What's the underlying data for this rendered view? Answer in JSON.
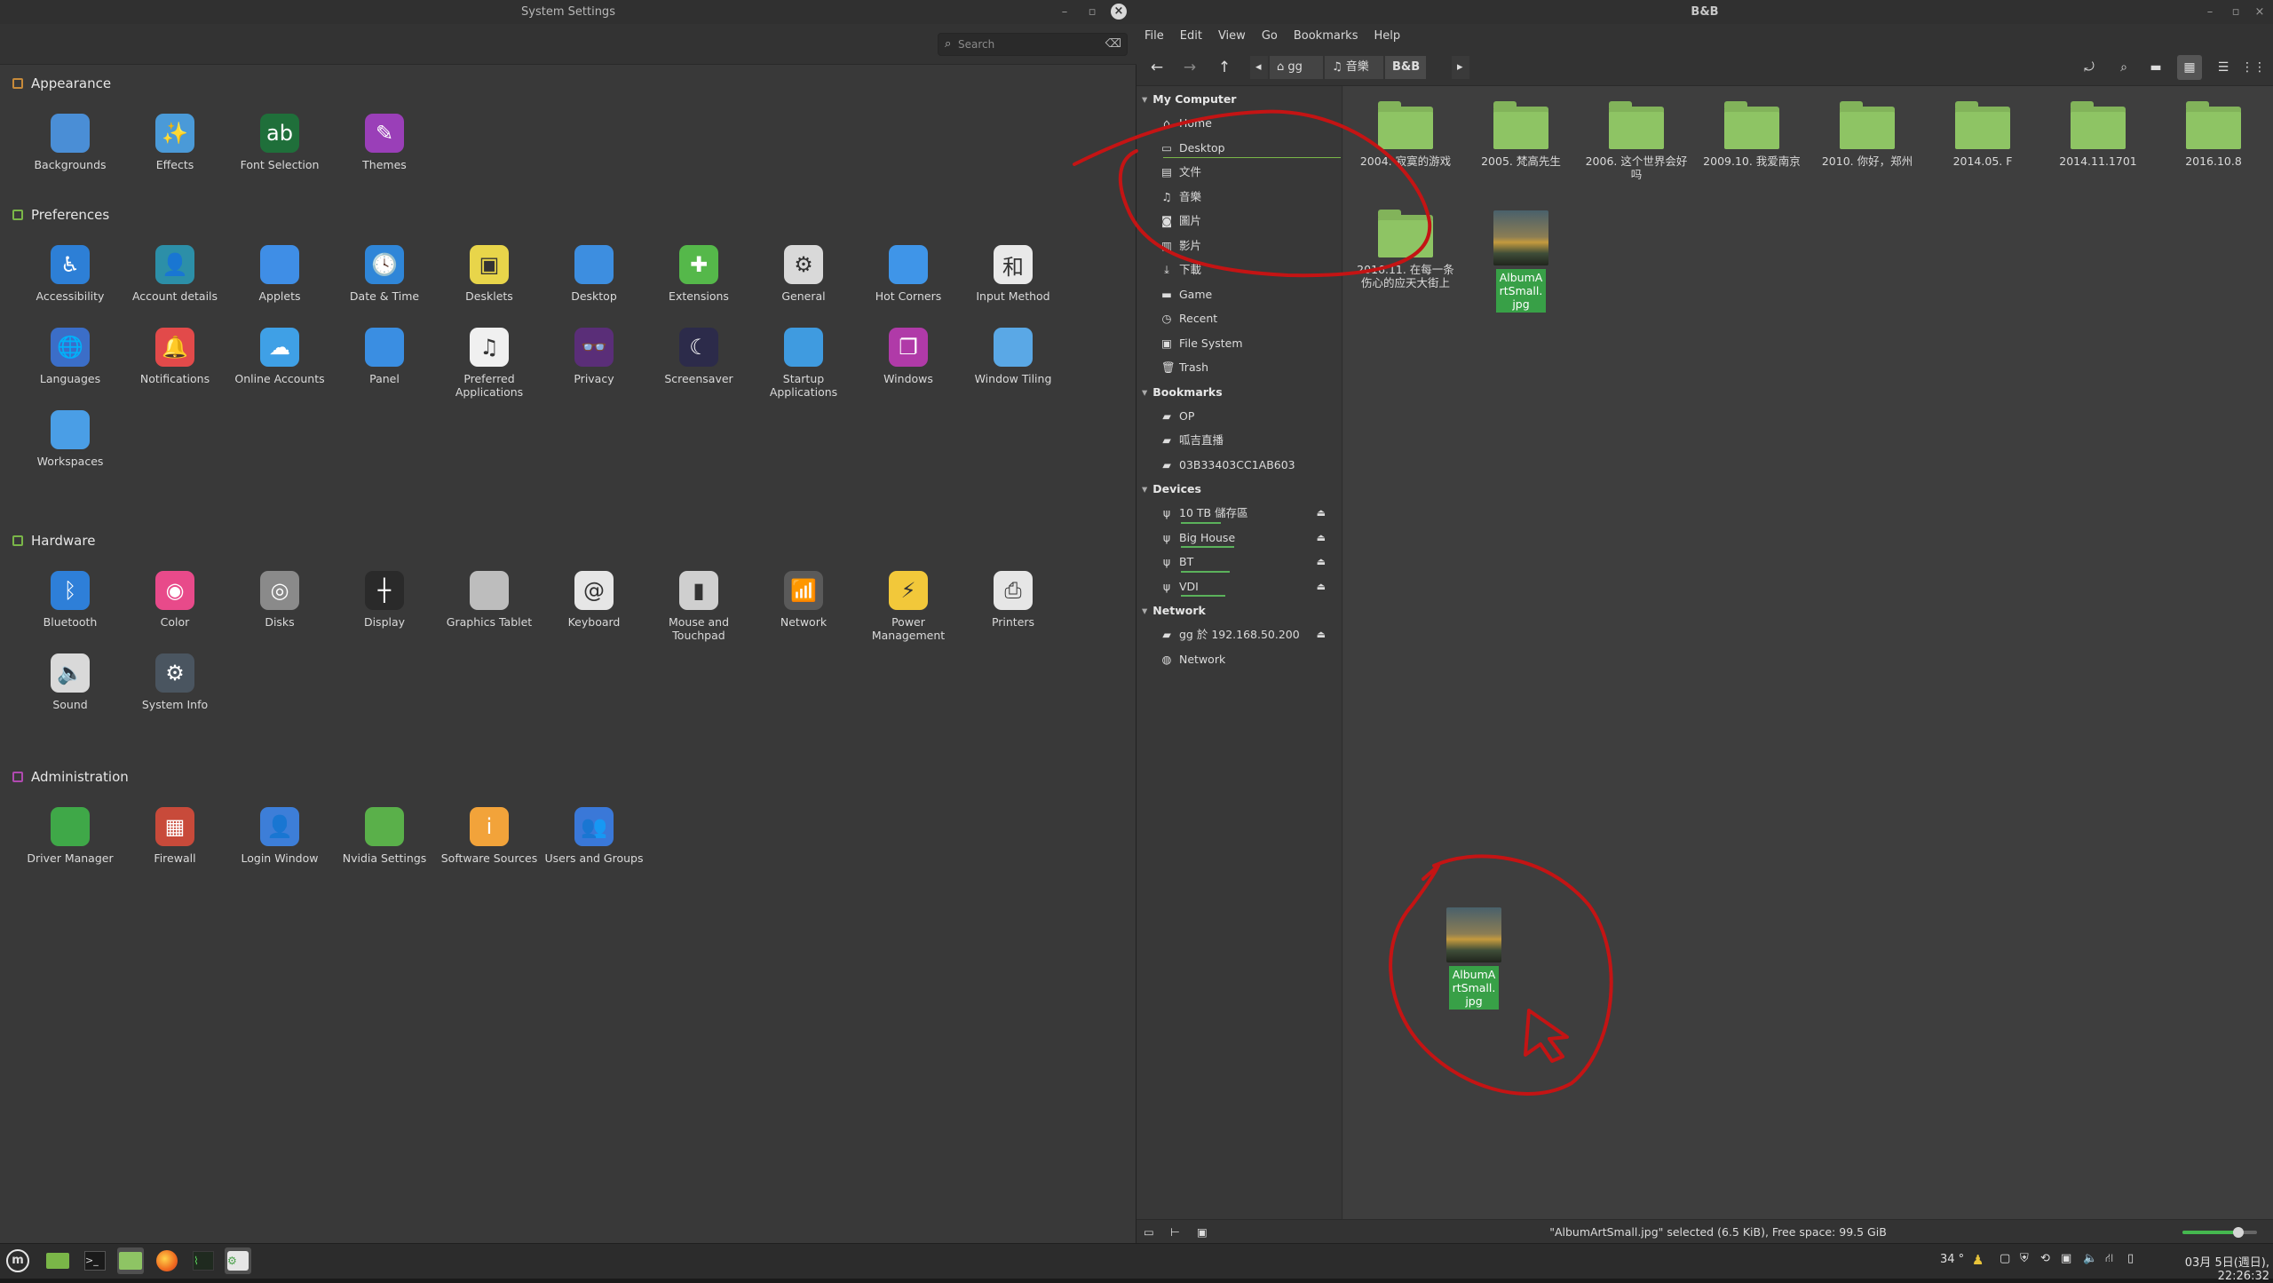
{
  "settings": {
    "title": "System Settings",
    "search_placeholder": "Search",
    "sections": [
      {
        "title": "Appearance",
        "color": "#c78a3a",
        "items": [
          {
            "label": "Backgrounds",
            "icon": "backgrounds-icon",
            "glyph": "",
            "color": "#4a8ed6"
          },
          {
            "label": "Effects",
            "icon": "effects-icon",
            "glyph": "✨",
            "color": "#4a9ad8"
          },
          {
            "label": "Font Selection",
            "icon": "font-selection-icon",
            "glyph": "ab",
            "color": "#1f6f3a"
          },
          {
            "label": "Themes",
            "icon": "themes-icon",
            "glyph": "✎",
            "color": "#9a3fb8"
          }
        ]
      },
      {
        "title": "Preferences",
        "color": "#7ab648",
        "items": [
          {
            "label": "Accessibility",
            "icon": "accessibility-icon",
            "glyph": "♿",
            "color": "#2d7fd6"
          },
          {
            "label": "Account details",
            "icon": "account-details-icon",
            "glyph": "👤",
            "color": "#2c8fa8"
          },
          {
            "label": "Applets",
            "icon": "applets-icon",
            "glyph": "",
            "color": "#3f8ee6"
          },
          {
            "label": "Date & Time",
            "icon": "date-time-icon",
            "glyph": "🕓",
            "color": "#2f86d8"
          },
          {
            "label": "Desklets",
            "icon": "desklets-icon",
            "glyph": "▣",
            "color": "#e8d54a"
          },
          {
            "label": "Desktop",
            "icon": "desktop-icon",
            "glyph": "",
            "color": "#3d8ee0"
          },
          {
            "label": "Extensions",
            "icon": "extensions-icon",
            "glyph": "✚",
            "color": "#55b84a"
          },
          {
            "label": "General",
            "icon": "general-icon",
            "glyph": "⚙",
            "color": "#d9d9d9"
          },
          {
            "label": "Hot Corners",
            "icon": "hot-corners-icon",
            "glyph": "",
            "color": "#3f95e8"
          },
          {
            "label": "Input Method",
            "icon": "input-method-icon",
            "glyph": "和",
            "color": "#e9e9e9"
          },
          {
            "label": "Languages",
            "icon": "languages-icon",
            "glyph": "🌐",
            "color": "#3b6ec8"
          },
          {
            "label": "Notifications",
            "icon": "notifications-icon",
            "glyph": "🔔",
            "color": "#e24a4a"
          },
          {
            "label": "Online Accounts",
            "icon": "online-accounts-icon",
            "glyph": "☁",
            "color": "#3fa0e6"
          },
          {
            "label": "Panel",
            "icon": "panel-icon",
            "glyph": "",
            "color": "#3a8ee2"
          },
          {
            "label": "Preferred Applications",
            "icon": "preferred-applications-icon",
            "glyph": "♫",
            "color": "#f0f0f0"
          },
          {
            "label": "Privacy",
            "icon": "privacy-icon",
            "glyph": "👓",
            "color": "#5a2e78"
          },
          {
            "label": "Screensaver",
            "icon": "screensaver-icon",
            "glyph": "☾",
            "color": "#2c2b4a"
          },
          {
            "label": "Startup Applications",
            "icon": "startup-applications-icon",
            "glyph": "",
            "color": "#3f9be0"
          },
          {
            "label": "Windows",
            "icon": "windows-icon",
            "glyph": "❐",
            "color": "#b03aa8"
          },
          {
            "label": "Window Tiling",
            "icon": "window-tiling-icon",
            "glyph": "",
            "color": "#5aa8e6"
          },
          {
            "label": "Workspaces",
            "icon": "workspaces-icon",
            "glyph": "",
            "color": "#4a9ee6"
          }
        ]
      },
      {
        "title": "Hardware",
        "color": "#7ab648",
        "items": [
          {
            "label": "Bluetooth",
            "icon": "bluetooth-icon",
            "glyph": "ᛒ",
            "color": "#2e7fd8"
          },
          {
            "label": "Color",
            "icon": "color-icon",
            "glyph": "◉",
            "color": "#e84a8a"
          },
          {
            "label": "Disks",
            "icon": "disks-icon",
            "glyph": "◎",
            "color": "#8a8a8a"
          },
          {
            "label": "Display",
            "icon": "display-icon",
            "glyph": "┼",
            "color": "#2a2a2a"
          },
          {
            "label": "Graphics Tablet",
            "icon": "graphics-tablet-icon",
            "glyph": "",
            "color": "#bdbdbd"
          },
          {
            "label": "Keyboard",
            "icon": "keyboard-icon",
            "glyph": "@",
            "color": "#e6e6e6"
          },
          {
            "label": "Mouse and Touchpad",
            "icon": "mouse-icon",
            "glyph": "▮",
            "color": "#cfcfcf"
          },
          {
            "label": "Network",
            "icon": "network-icon",
            "glyph": "📶",
            "color": "#5a5a5a"
          },
          {
            "label": "Power Management",
            "icon": "power-management-icon",
            "glyph": "⚡",
            "color": "#f2c83a"
          },
          {
            "label": "Printers",
            "icon": "printers-icon",
            "glyph": "⎙",
            "color": "#e6e6e6"
          },
          {
            "label": "Sound",
            "icon": "sound-icon",
            "glyph": "🔈",
            "color": "#d9d9d9"
          },
          {
            "label": "System Info",
            "icon": "system-info-icon",
            "glyph": "⚙",
            "color": "#4a5560"
          }
        ]
      },
      {
        "title": "Administration",
        "color": "#b04ab0",
        "items": [
          {
            "label": "Driver Manager",
            "icon": "driver-manager-icon",
            "glyph": "",
            "color": "#3fa848"
          },
          {
            "label": "Firewall",
            "icon": "firewall-icon",
            "glyph": "▦",
            "color": "#c84a3a"
          },
          {
            "label": "Login Window",
            "icon": "login-window-icon",
            "glyph": "👤",
            "color": "#3d7ed8"
          },
          {
            "label": "Nvidia Settings",
            "icon": "nvidia-settings-icon",
            "glyph": "",
            "color": "#5ab04a"
          },
          {
            "label": "Software Sources",
            "icon": "software-sources-icon",
            "glyph": "i",
            "color": "#f2a33a"
          },
          {
            "label": "Users and Groups",
            "icon": "users-groups-icon",
            "glyph": "👥",
            "color": "#3a78d8"
          }
        ]
      }
    ]
  },
  "filemanager": {
    "title": "B&B",
    "menu": [
      "File",
      "Edit",
      "View",
      "Go",
      "Bookmarks",
      "Help"
    ],
    "breadcrumbs": [
      "gg",
      "音樂",
      "B&B"
    ],
    "sidebar": {
      "my_computer": "My Computer",
      "places": [
        {
          "label": "Home",
          "glyph": "⌂"
        },
        {
          "label": "Desktop",
          "glyph": "▭"
        },
        {
          "label": "文件",
          "glyph": "▤"
        },
        {
          "label": "音樂",
          "glyph": "♫"
        },
        {
          "label": "圖片",
          "glyph": "◙"
        },
        {
          "label": "影片",
          "glyph": "▥"
        },
        {
          "label": "下載",
          "glyph": "⤓"
        },
        {
          "label": "Game",
          "glyph": "▬"
        },
        {
          "label": "Recent",
          "glyph": "◷"
        },
        {
          "label": "File System",
          "glyph": "▣"
        },
        {
          "label": "Trash",
          "glyph": "🗑"
        }
      ],
      "bookmarks_title": "Bookmarks",
      "bookmarks": [
        {
          "label": "OP",
          "glyph": "▰"
        },
        {
          "label": "呱吉直播",
          "glyph": "▰"
        },
        {
          "label": "03B33403CC1AB603",
          "glyph": "▰"
        }
      ],
      "devices_title": "Devices",
      "devices": [
        {
          "label": "10 TB 儲存區",
          "glyph": "ψ",
          "usage": 0.45
        },
        {
          "label": "Big House",
          "glyph": "ψ",
          "usage": 0.6
        },
        {
          "label": "BT",
          "glyph": "ψ",
          "usage": 0.55
        },
        {
          "label": "VDI",
          "glyph": "ψ",
          "usage": 0.5
        }
      ],
      "network_title": "Network",
      "network": [
        {
          "label": "gg 於 192.168.50.200",
          "glyph": "▰"
        },
        {
          "label": "Network",
          "glyph": "◍"
        }
      ]
    },
    "items": [
      "2004. 寂寞的游戏",
      "2005. 梵高先生",
      "2006. 这个世界会好吗",
      "2009.10. 我爱南京",
      "2010. 你好，郑州",
      "2014.05. F",
      "2014.11.1701",
      "2016.10.8",
      "2016.11. 在每一条伤心的应天大街上"
    ],
    "selected_file": "AlbumArtSmall.jpg",
    "status": "\"AlbumArtSmall.jpg\" selected (6.5 KiB), Free space: 99.5 GiB",
    "zoom": 0.75
  },
  "taskbar": {
    "temperature": "34 °",
    "clock": "03月 5日(週日), 22:26:32"
  },
  "colors": {
    "annotation": "#c41414",
    "selection": "#38a047",
    "folder": "#8ec464"
  }
}
